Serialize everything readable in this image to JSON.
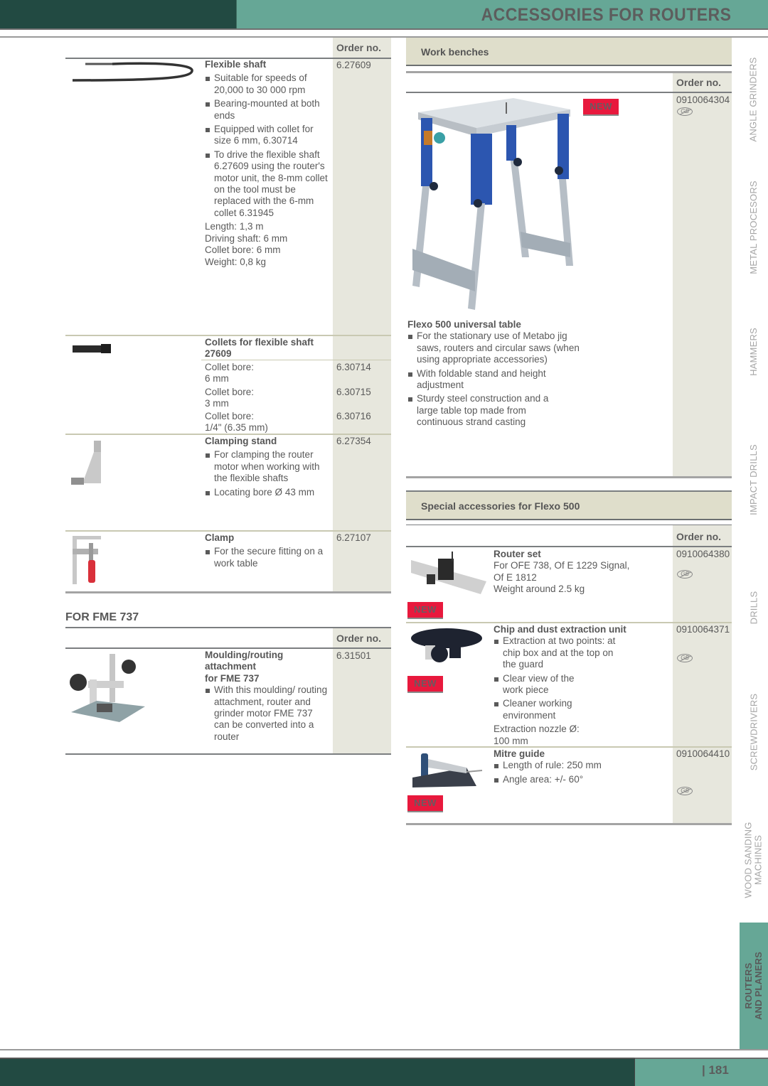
{
  "header": {
    "title": "ACCESSORIES FOR ROUTERS"
  },
  "left": {
    "order_header": "Order no.",
    "items": [
      {
        "name": "Flexible shaft",
        "order_no": "6.27609",
        "bullets": [
          "Suitable for speeds of 20,000 to 30 000 rpm",
          "Bearing-mounted at both ends",
          "Equipped with collet for size 6 mm, 6.30714",
          "To drive the flexible shaft 6.27609 using the router's motor unit, the 8-mm collet on the tool must be replaced with the 6-mm collet 6.31945"
        ],
        "specs": [
          "Length: 1,3 m",
          "Driving shaft: 6 mm",
          "Collet bore: 6 mm",
          "Weight: 0,8 kg"
        ],
        "icon": "flexible-shaft-image"
      },
      {
        "name": "Collets for flexible shaft 27609",
        "icon": "collet-image",
        "variants": [
          {
            "label": "Collet bore:",
            "value": "6 mm",
            "order_no": "6.30714"
          },
          {
            "label": "Collet bore:",
            "value": "3 mm",
            "order_no": "6.30715"
          },
          {
            "label": "Collet bore:",
            "value": "1/4\" (6.35 mm)",
            "order_no": "6.30716"
          }
        ]
      },
      {
        "name": "Clamping stand",
        "order_no": "6.27354",
        "bullets": [
          "For clamping the router motor when working with the flexible shafts",
          "Locating bore Ø 43 mm"
        ],
        "icon": "clamping-stand-image"
      },
      {
        "name": "Clamp",
        "order_no": "6.27107",
        "bullets": [
          "For the secure fitting on a work table"
        ],
        "icon": "clamp-image"
      }
    ],
    "fme_section": {
      "heading": "FOR FME 737",
      "order_header": "Order no.",
      "item": {
        "name_lines": [
          "Moulding/routing",
          "attachment",
          "for FME 737"
        ],
        "order_no": "6.31501",
        "bullets": [
          "With this moulding/ routing attachment, router and grinder motor FME 737 can be converted into a router"
        ],
        "icon": "moulding-attachment-image"
      }
    }
  },
  "right": {
    "workbench_section": {
      "title": "Work benches",
      "order_header": "Order no.",
      "item": {
        "name": "Flexo 500 universal table",
        "order_no": "0910064304",
        "badge": "NEW",
        "country_mark": "GB",
        "bullets": [
          "For the stationary use of Metabo jig saws, routers and circular saws (when using appropriate accessories)",
          "With foldable stand and height adjustment",
          "Sturdy steel construction and a large table top made from continuous strand casting"
        ]
      }
    },
    "special_section": {
      "title": "Special accessories for Flexo 500",
      "order_header": "Order no.",
      "items": [
        {
          "name": "Router set",
          "order_no": "0910064380",
          "badge": "NEW",
          "country_mark": "GB",
          "lines": [
            "For OFE 738, Of E 1229 Signal,",
            "Of E 1812",
            "Weight around 2.5 kg"
          ]
        },
        {
          "name": "Chip and dust extraction unit",
          "order_no": "0910064371",
          "badge": "NEW",
          "country_mark": "GB",
          "bullets": [
            "Extraction at two points: at chip box and at the top on the guard",
            "Clear view of the work piece",
            "Cleaner working environment"
          ],
          "specs": [
            "Extraction nozzle Ø:",
            "100 mm"
          ]
        },
        {
          "name": "Mitre guide",
          "order_no": "0910064410",
          "badge": "NEW",
          "country_mark": "GB",
          "bullets": [
            "Length of rule: 250 mm",
            "Angle area: +/- 60°"
          ]
        }
      ]
    }
  },
  "side_tabs": [
    {
      "label": "ANGLE GRINDERS",
      "active": false
    },
    {
      "label": "METAL PROCESORS",
      "active": false
    },
    {
      "label": "HAMMERS",
      "active": false
    },
    {
      "label": "IMPACT DRILLS",
      "active": false
    },
    {
      "label": "DRILLS",
      "active": false
    },
    {
      "label": "SCREWDRIVERS",
      "active": false
    },
    {
      "label": "WOOD SANDING\nMACHINES",
      "active": false
    },
    {
      "label": "ROUTERS\nAND PLANERS",
      "active": true
    }
  ],
  "footer": {
    "page_number": "| 181"
  },
  "colors": {
    "dark_green": "#224a42",
    "light_green": "#66a796",
    "shade": "#e7e7dd",
    "band": "#dfdecb",
    "new_red": "#e8193d"
  }
}
